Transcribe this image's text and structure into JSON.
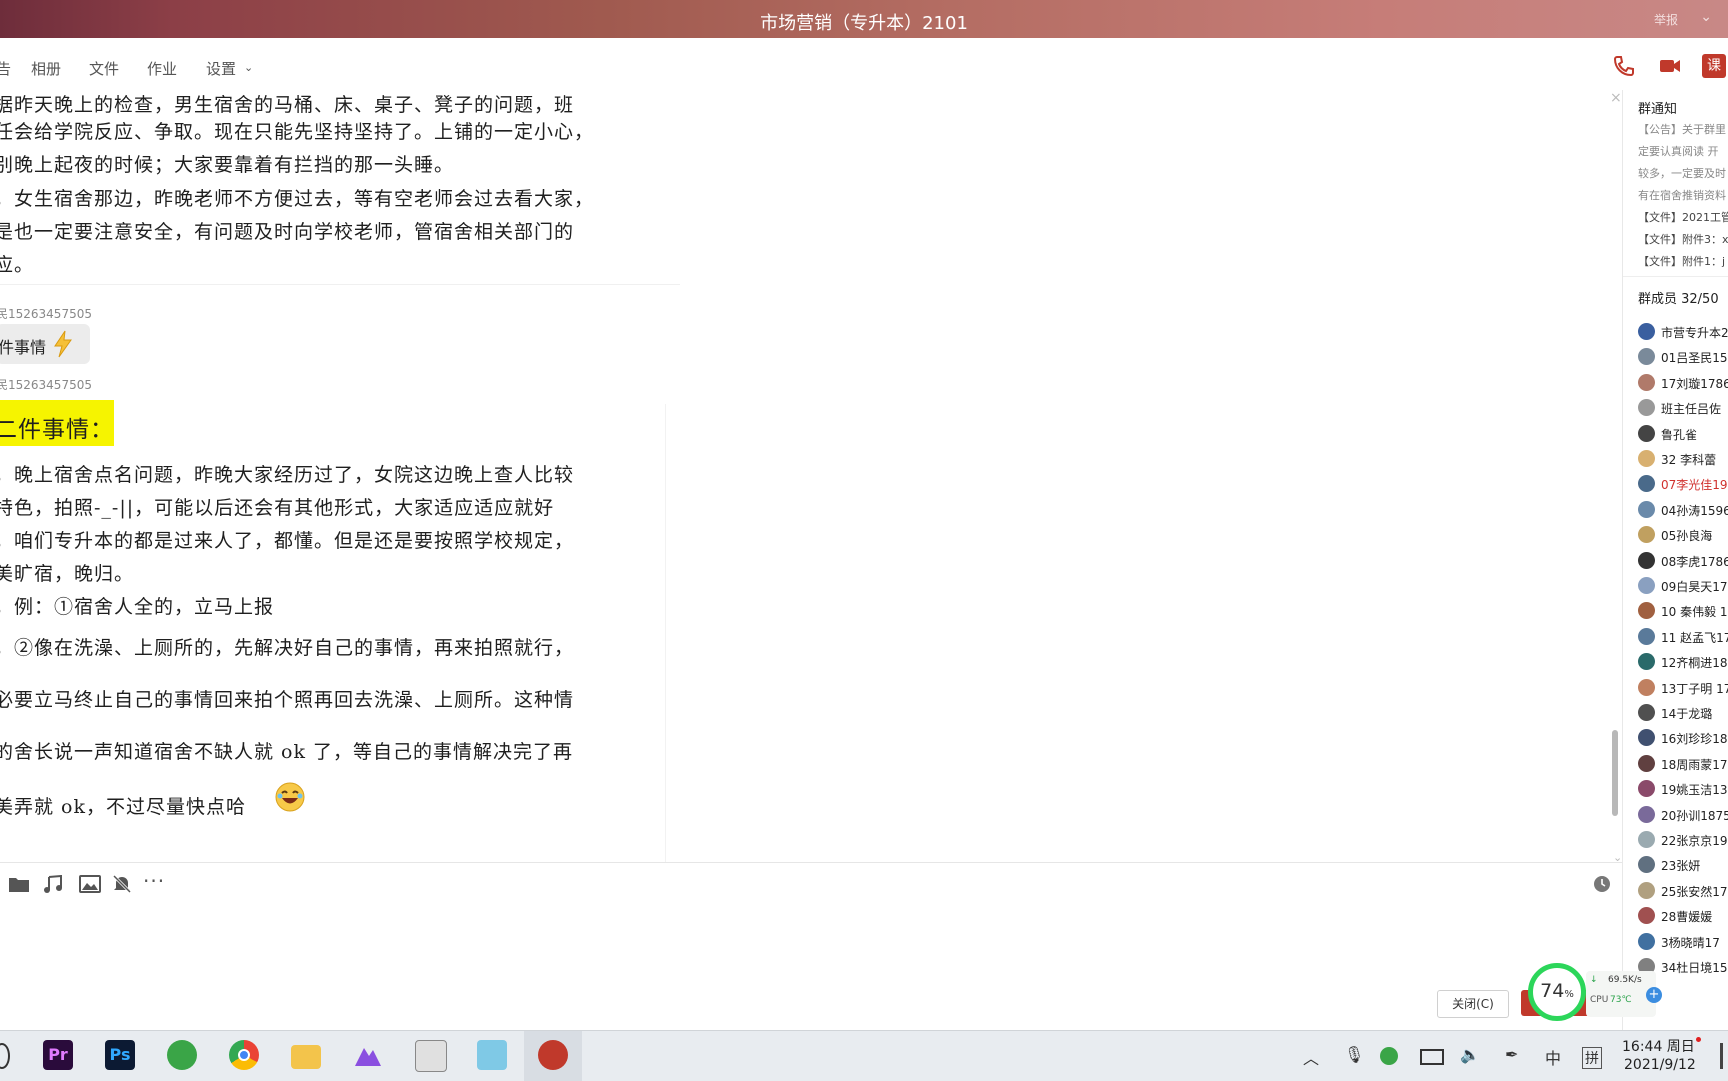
{
  "window": {
    "title": "市场营销（专升本）2101",
    "report_label": "举报"
  },
  "toolbar": {
    "tabs": [
      "告",
      "相册",
      "文件",
      "作业",
      "设置"
    ],
    "lesson_label": "课"
  },
  "messages": {
    "block1_lines": [
      "据昨天晚上的检查，男生宿舍的马桶、床、桌子、凳子的问题，班",
      "任会给学院反应、争取。现在只能先坚持坚持了。上铺的一定小心，",
      "别晚上起夜的时候；大家要靠着有拦挡的那一头睡。",
      "，女生宿舍那边，昨晚老师不方便过去，等有空老师会过去看大家，",
      "是也一定要注意安全，有问题及时向学校老师，管宿舍相关部门的",
      "应。"
    ],
    "sender1": "民15263457505",
    "short_msg": "件事情",
    "sender2": "民15263457505",
    "highlight": "二件事情：",
    "block2_lines": [
      "，晚上宿舍点名问题，昨晚大家经历过了，女院这边晚上查人比较",
      "特色，拍照-_-||，可能以后还会有其他形式，大家适应适应就好",
      "，咱们专升本的都是过来人了，都懂。但是还是要按照学校规定，",
      "美旷宿，晚归。",
      "，例：①宿舍人全的，立马上报",
      "，②像在洗澡、上厕所的，先解决好自己的事情，再来拍照就行，",
      "必要立马终止自己的事情回来拍个照再回去洗澡、上厕所。这种情",
      "的舍长说一声知道宿舍不缺人就 ok 了，等自己的事情解决完了再",
      "美弄就 ok，不过尽量快点哈"
    ]
  },
  "sidebar": {
    "notice_title": "群通知",
    "notices": [
      "【公告】关于群里",
      "定要认真阅读 开",
      "较多，一定要及时",
      "有在宿舍推销资料",
      "【文件】2021工管",
      "【文件】附件3：x",
      "【文件】附件1：j"
    ],
    "members_title": "群成员 32/50",
    "members": [
      "市营专升本2",
      "01吕圣民15",
      "17刘璇1786",
      "班主任吕佐",
      "鲁孔雀",
      "32 李科蕾",
      "07李光佳19",
      "04孙涛1596",
      "05孙良海",
      "08李虎1786",
      "09白昊天17",
      "10 秦伟毅 1",
      "11 赵孟飞17",
      "12齐桐进18",
      "13丁子明 17",
      "14于龙璐",
      "16刘珍珍18",
      "18周雨蒙17",
      "19姚玉洁13",
      "20孙训1875",
      "22张京京19",
      "23张妍",
      "25张安然17",
      "28曹媛媛",
      "3杨晓晴17",
      "34杜日境15"
    ],
    "highlight_member_color": "#d0312d"
  },
  "input": {
    "close_label": "关闭(C)"
  },
  "monitor": {
    "percent": "74",
    "percent_unit": "%",
    "net_speed": "69.5K/s",
    "cpu_label": "CPU",
    "cpu_temp": "73℃"
  },
  "taskbar": {
    "pr_label": "Pr",
    "ps_label": "Ps",
    "ime_zh": "中",
    "ime_pin": "拼",
    "time": "16:44 周日",
    "date": "2021/9/12"
  },
  "colors": {
    "highlight_bg": "#f6f400",
    "monitor_ring": "#2cd65a"
  }
}
